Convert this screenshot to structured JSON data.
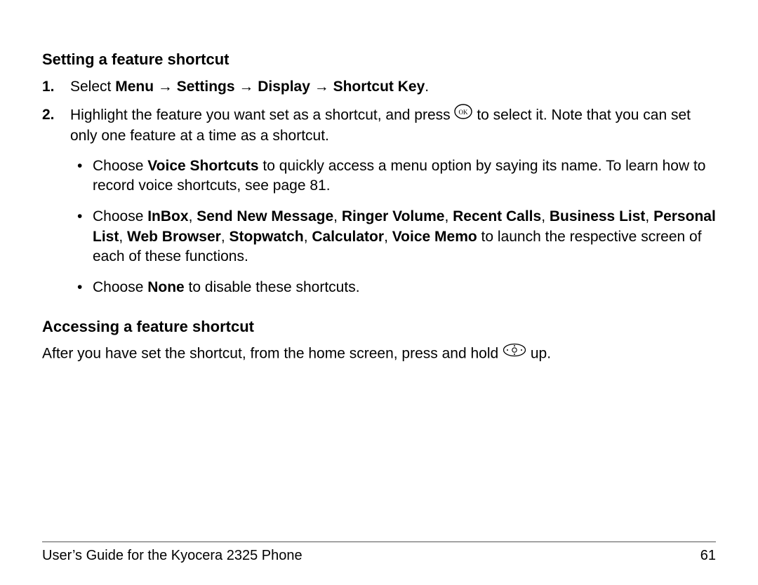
{
  "section1": {
    "heading": "Setting a feature shortcut",
    "step1_num": "1.",
    "step1_pre": "Select ",
    "step1_menu": "Menu",
    "step1_arrow": " → ",
    "step1_settings": "Settings",
    "step1_display": "Display",
    "step1_shortcut": "Shortcut Key",
    "step1_period": ".",
    "step2_num": "2.",
    "step2_a": "Highlight the feature you want set as a shortcut, and press ",
    "step2_b": " to select it. Note that you can set only one feature at a time as a shortcut.",
    "bullet1_a": "Choose ",
    "bullet1_b": "Voice Shortcuts",
    "bullet1_c": " to quickly access a menu option by saying its name. To learn how to record voice shortcuts, see page 81.",
    "bullet2_a": "Choose ",
    "bullet2_inbox": "InBox",
    "bullet2_comma": ", ",
    "bullet2_send": "Send New Message",
    "bullet2_ringer": "Ringer Volume",
    "bullet2_recent": "Recent Calls",
    "bullet2_biz": "Business List",
    "bullet2_personal": "Personal List",
    "bullet2_web": "Web Browser",
    "bullet2_stop": "Stopwatch",
    "bullet2_calc": "Calculator",
    "bullet2_voice": "Voice Memo",
    "bullet2_tail": " to launch the respective screen of each of these functions.",
    "bullet3_a": "Choose ",
    "bullet3_b": "None",
    "bullet3_c": " to disable these shortcuts."
  },
  "section2": {
    "heading": "Accessing a feature shortcut",
    "line_a": "After you have set the shortcut, from the home screen, press and hold ",
    "line_b": " up."
  },
  "footer": {
    "left": "User’s Guide for the Kyocera 2325 Phone",
    "right": "61"
  }
}
